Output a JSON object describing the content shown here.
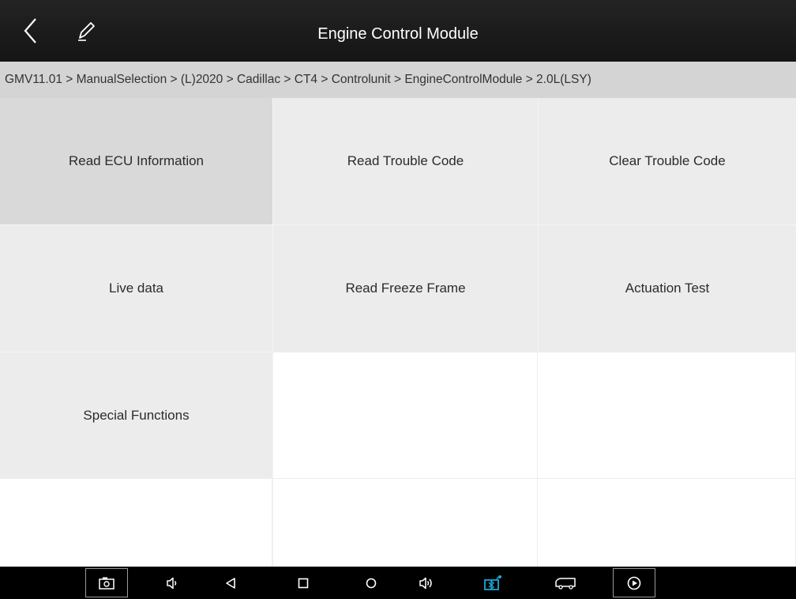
{
  "header": {
    "title": "Engine Control Module",
    "back_icon": "back-arrow-icon",
    "edit_icon": "pen-icon"
  },
  "breadcrumb": "GMV11.01 > ManualSelection > (L)2020 > Cadillac > CT4 > Controlunit > EngineControlModule > 2.0L(LSY)",
  "functions": [
    {
      "label": "Read ECU Information",
      "selected": true
    },
    {
      "label": "Read Trouble Code"
    },
    {
      "label": "Clear Trouble Code"
    },
    {
      "label": "Live data"
    },
    {
      "label": "Read Freeze Frame"
    },
    {
      "label": "Actuation Test"
    },
    {
      "label": "Special Functions"
    }
  ],
  "navbar": {
    "icons": [
      "screenshot-icon",
      "volume-down-icon",
      "back-icon",
      "recents-icon",
      "home-icon",
      "volume-up-icon",
      "vci-connection-icon",
      "vehicle-icon",
      "play-icon"
    ],
    "accent_color": "#1aa9d6"
  },
  "colors": {
    "title_bar": "#1b1b1b",
    "breadcrumb_bg": "#d4d4d4",
    "cell_bg": "#ececec",
    "selected_cell_bg": "#d9d9d9"
  }
}
